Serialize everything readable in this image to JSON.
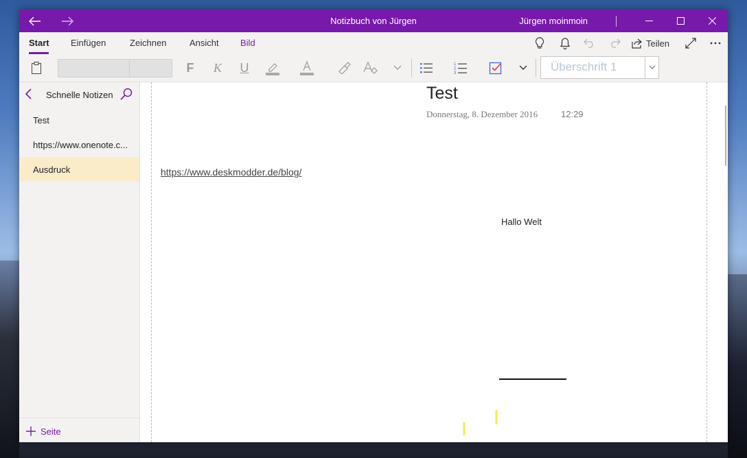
{
  "window": {
    "title": "Notizbuch von Jürgen",
    "user": "Jürgen moinmoin"
  },
  "ribbon": {
    "tabs": [
      {
        "label": "Start"
      },
      {
        "label": "Einfügen"
      },
      {
        "label": "Zeichnen"
      },
      {
        "label": "Ansicht"
      },
      {
        "label": "Bild"
      }
    ],
    "share_label": "Teilen",
    "style_value": "Überschrift 1"
  },
  "sidebar": {
    "section_title": "Schnelle Notizen",
    "pages": [
      {
        "label": "Test"
      },
      {
        "label": "https://www.onenote.c..."
      },
      {
        "label": "Ausdruck"
      }
    ],
    "add_page_label": "Seite"
  },
  "page": {
    "title": "Test",
    "date": "Donnerstag, 8. Dezember 2016",
    "time": "12:29",
    "link": "https://www.deskmodder.de/blog/",
    "text": "Hallo Welt"
  },
  "colors": {
    "accent": "#7719aa",
    "selected_page": "#fbecc9",
    "ink_highlight": "#f2ee4a"
  },
  "icons": [
    "back-icon",
    "forward-icon",
    "minimize-icon",
    "maximize-icon",
    "close-icon",
    "lightbulb-icon",
    "bell-icon",
    "undo-icon",
    "redo-icon",
    "share-icon",
    "fullscreen-icon",
    "more-icon",
    "clipboard-icon",
    "bold-icon",
    "italic-icon",
    "underline-icon",
    "highlighter-icon",
    "font-color-icon",
    "format-painter-icon",
    "clear-format-icon",
    "bullet-list-icon",
    "numbered-list-icon",
    "todo-checkbox-icon",
    "search-icon",
    "add-icon"
  ]
}
